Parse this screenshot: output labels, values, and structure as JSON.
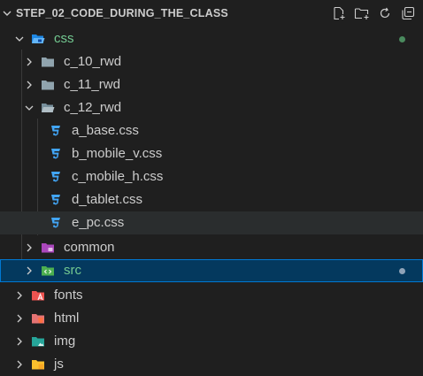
{
  "explorer": {
    "section_title": "STEP_02_CODE_DURING_THE_CLASS",
    "actions": [
      {
        "name": "new-file-icon"
      },
      {
        "name": "new-folder-icon"
      },
      {
        "name": "refresh-icon"
      },
      {
        "name": "collapse-all-icon"
      }
    ]
  },
  "tree": {
    "css": "css",
    "c_10_rwd": "c_10_rwd",
    "c_11_rwd": "c_11_rwd",
    "c_12_rwd": "c_12_rwd",
    "a_base": "a_base.css",
    "b_mobile_v": "b_mobile_v.css",
    "c_mobile_h": "c_mobile_h.css",
    "d_tablet": "d_tablet.css",
    "e_pc": "e_pc.css",
    "common": "common",
    "src": "src",
    "fonts": "fonts",
    "html": "html",
    "img": "img",
    "js": "js"
  },
  "colors": {
    "background": "#1f1f1f",
    "selection": "#04395e",
    "selection_border": "#0078d4",
    "modified_green": "#73c991",
    "css_icon": "#42a5f5"
  }
}
